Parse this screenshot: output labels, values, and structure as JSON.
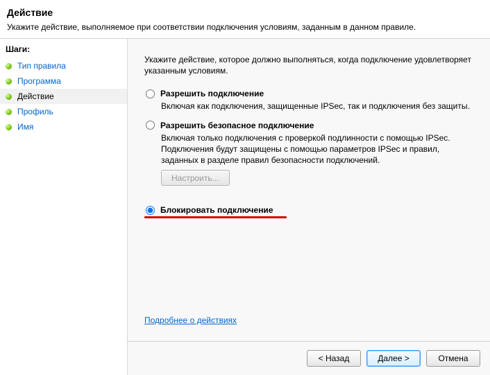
{
  "header": {
    "title": "Действие",
    "subtitle": "Укажите действие, выполняемое при соответствии подключения условиям, заданным в данном правиле."
  },
  "sidebar": {
    "steps_title": "Шаги:",
    "items": [
      {
        "label": "Тип правила"
      },
      {
        "label": "Программа"
      },
      {
        "label": "Действие"
      },
      {
        "label": "Профиль"
      },
      {
        "label": "Имя"
      }
    ],
    "current_index": 2
  },
  "main": {
    "instruction": "Укажите действие, которое должно выполняться, когда подключение удовлетворяет указанным условиям.",
    "options": [
      {
        "label": "Разрешить подключение",
        "desc": "Включая как подключения, защищенные IPSec, так и подключения без защиты."
      },
      {
        "label": "Разрешить безопасное подключение",
        "desc": "Включая только подключения с проверкой подлинности с помощью IPSec. Подключения будут защищены с помощью параметров IPSec и правил, заданных в разделе правил безопасности подключений.",
        "config_label": "Настроить..."
      },
      {
        "label": "Блокировать подключение"
      }
    ],
    "selected_index": 2,
    "learn_more": "Подробнее о действиях"
  },
  "footer": {
    "back": "< Назад",
    "next": "Далее >",
    "cancel": "Отмена"
  }
}
